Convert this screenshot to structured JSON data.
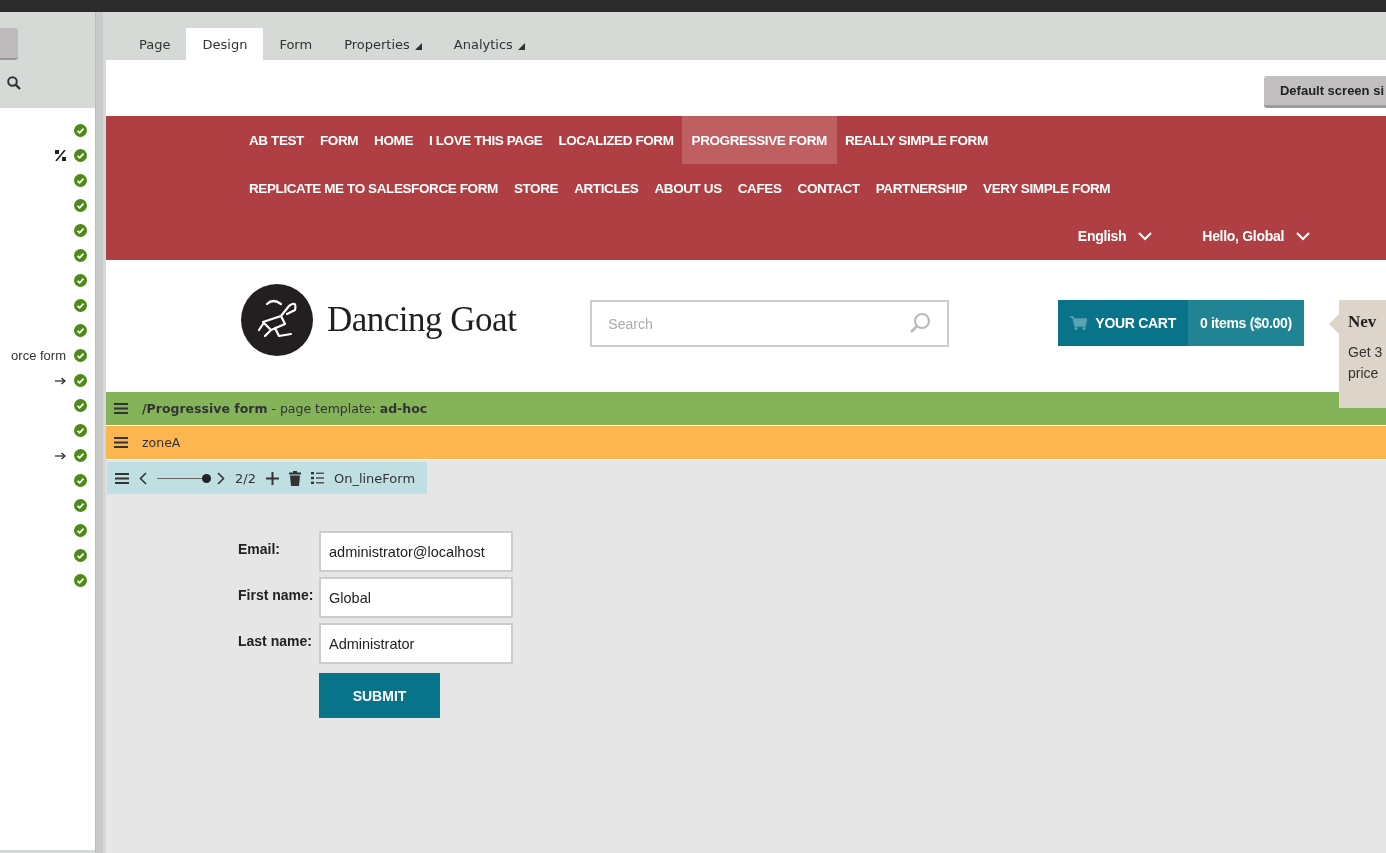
{
  "sidebar": {
    "rows": [
      {
        "kind": "plain"
      },
      {
        "kind": "percent"
      },
      {
        "kind": "plain"
      },
      {
        "kind": "plain"
      },
      {
        "kind": "plain"
      },
      {
        "kind": "plain"
      },
      {
        "kind": "plain"
      },
      {
        "kind": "plain"
      },
      {
        "kind": "plain"
      },
      {
        "kind": "text",
        "label": "orce form"
      },
      {
        "kind": "arrow"
      },
      {
        "kind": "plain"
      },
      {
        "kind": "plain"
      },
      {
        "kind": "arrow"
      },
      {
        "kind": "plain"
      },
      {
        "kind": "plain"
      },
      {
        "kind": "plain"
      },
      {
        "kind": "plain"
      },
      {
        "kind": "plain"
      }
    ]
  },
  "tabs": [
    {
      "label": "Page",
      "selected": false,
      "dropdown": false
    },
    {
      "label": "Design",
      "selected": true,
      "dropdown": false
    },
    {
      "label": "Form",
      "selected": false,
      "dropdown": false
    },
    {
      "label": "Properties",
      "selected": false,
      "dropdown": true
    },
    {
      "label": "Analytics",
      "selected": false,
      "dropdown": true
    }
  ],
  "screen_size_button": "Default screen si",
  "nav": {
    "items": [
      {
        "label": "AB TEST",
        "selected": false
      },
      {
        "label": "FORM",
        "selected": false
      },
      {
        "label": "HOME",
        "selected": false
      },
      {
        "label": "I LOVE THIS PAGE",
        "selected": false
      },
      {
        "label": "LOCALIZED FORM",
        "selected": false
      },
      {
        "label": "PROGRESSIVE FORM",
        "selected": true
      },
      {
        "label": "REALLY SIMPLE FORM",
        "selected": false
      },
      {
        "label": "REPLICATE ME TO SALESFORCE FORM",
        "selected": false
      },
      {
        "label": "STORE",
        "selected": false
      },
      {
        "label": "ARTICLES",
        "selected": false
      },
      {
        "label": "ABOUT US",
        "selected": false
      },
      {
        "label": "CAFES",
        "selected": false
      },
      {
        "label": "CONTACT",
        "selected": false
      },
      {
        "label": "PARTNERSHIP",
        "selected": false
      },
      {
        "label": "VERY SIMPLE FORM",
        "selected": false
      }
    ],
    "language": "English",
    "user": "Hello, Global"
  },
  "header": {
    "logo_text": "Dancing Goat",
    "search_placeholder": "Search",
    "cart_label": "YOUR CART",
    "cart_summary": "0 items ($0.00)",
    "newsletter": {
      "title": "Nev",
      "lines": [
        "Get 3",
        "price"
      ]
    }
  },
  "page_bar": {
    "text": "**/Progressive form** - page template: **ad-hoc**"
  },
  "zone": {
    "name": "zoneA"
  },
  "widget_toolbar": {
    "level": 1,
    "counter": "2/2",
    "widget_name": "On_lineForm"
  },
  "form": {
    "fields": [
      {
        "label": "Email:",
        "value": "administrator@localhost"
      },
      {
        "label": "First name:",
        "value": "Global"
      },
      {
        "label": "Last name:",
        "value": "Administrator"
      }
    ],
    "submit": "SUBMIT"
  }
}
